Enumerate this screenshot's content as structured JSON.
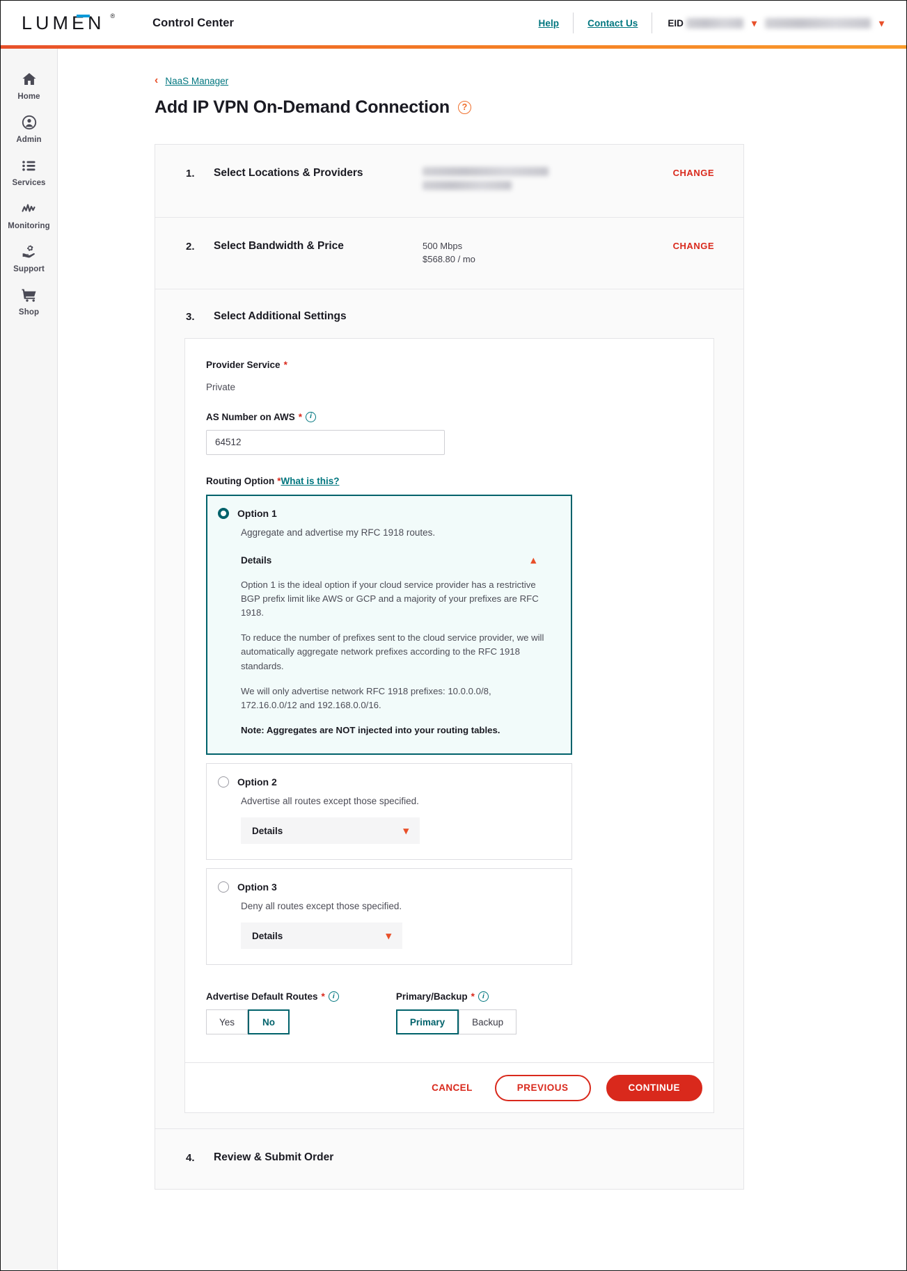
{
  "header": {
    "logo_text": "LUMEN",
    "logo_registered": "®",
    "app_title": "Control Center",
    "help_label": "Help",
    "contact_label": "Contact Us",
    "eid_label": "EID",
    "eid_value_masked": "",
    "account_value_masked": ""
  },
  "sidebar": {
    "items": [
      {
        "label": "Home",
        "icon": "home-icon"
      },
      {
        "label": "Admin",
        "icon": "user-circle-icon"
      },
      {
        "label": "Services",
        "icon": "list-icon"
      },
      {
        "label": "Monitoring",
        "icon": "waveform-icon"
      },
      {
        "label": "Support",
        "icon": "gear-hand-icon"
      },
      {
        "label": "Shop",
        "icon": "cart-icon"
      }
    ]
  },
  "breadcrumb": {
    "back_icon": "chevron-left-icon",
    "link_label": "NaaS Manager"
  },
  "page": {
    "title": "Add IP VPN On-Demand Connection",
    "help_icon_label": "?"
  },
  "steps": [
    {
      "number": "1.",
      "title": "Select Locations & Providers",
      "value_masked_1": "",
      "value_masked_2": "",
      "action_label": "CHANGE"
    },
    {
      "number": "2.",
      "title": "Select Bandwidth & Price",
      "value_line_1": "500 Mbps",
      "value_line_2": "$568.80 / mo",
      "action_label": "CHANGE"
    },
    {
      "number": "3.",
      "title": "Select Additional Settings"
    },
    {
      "number": "4.",
      "title": "Review & Submit Order"
    }
  ],
  "form": {
    "provider_service": {
      "label": "Provider Service",
      "required_mark": "*",
      "value": "Private"
    },
    "as_number": {
      "label": "AS Number on AWS",
      "required_mark": "*",
      "info_icon": "info-icon",
      "value": "64512",
      "placeholder": "AS Number"
    },
    "routing": {
      "label": "Routing Option",
      "required_mark": "*",
      "help_link": "What is this?",
      "options": [
        {
          "name": "Option 1",
          "description": "Aggregate and advertise my RFC 1918 routes.",
          "selected": true,
          "details_label": "Details",
          "expanded": true,
          "caret_icon": "chevron-up-icon",
          "paragraphs": [
            "Option 1 is the ideal option if your cloud service provider has a restrictive BGP prefix limit like AWS or GCP and a majority of your prefixes are RFC 1918.",
            "To reduce the number of prefixes sent to the cloud service provider, we will automatically aggregate network prefixes according to the RFC 1918 standards.",
            "We will only advertise network RFC 1918 prefixes: 10.0.0.0/8, 172.16.0.0/12 and 192.168.0.0/16."
          ],
          "note": "Note: Aggregates are NOT injected into your routing tables."
        },
        {
          "name": "Option 2",
          "description": "Advertise all routes except those specified.",
          "selected": false,
          "details_label": "Details",
          "expanded": false,
          "caret_icon": "chevron-down-icon"
        },
        {
          "name": "Option 3",
          "description": "Deny all routes except those specified.",
          "selected": false,
          "details_label": "Details",
          "expanded": false,
          "caret_icon": "chevron-down-icon"
        }
      ]
    },
    "advertise_default_routes": {
      "label": "Advertise Default Routes",
      "required_mark": "*",
      "info_icon": "info-icon",
      "options": [
        "Yes",
        "No"
      ],
      "selected": "No"
    },
    "primary_backup": {
      "label": "Primary/Backup",
      "required_mark": "*",
      "info_icon": "info-icon",
      "options": [
        "Primary",
        "Backup"
      ],
      "selected": "Primary"
    }
  },
  "actions": {
    "cancel_label": "CANCEL",
    "previous_label": "PREVIOUS",
    "continue_label": "CONTINUE"
  },
  "colors": {
    "brand_orange": "#ef6f2c",
    "brand_red": "#d9291c",
    "teal": "#00767f",
    "teal_dark": "#00626b",
    "teal_bg": "#f2fbfa",
    "logo_blue": "#0099d8"
  }
}
